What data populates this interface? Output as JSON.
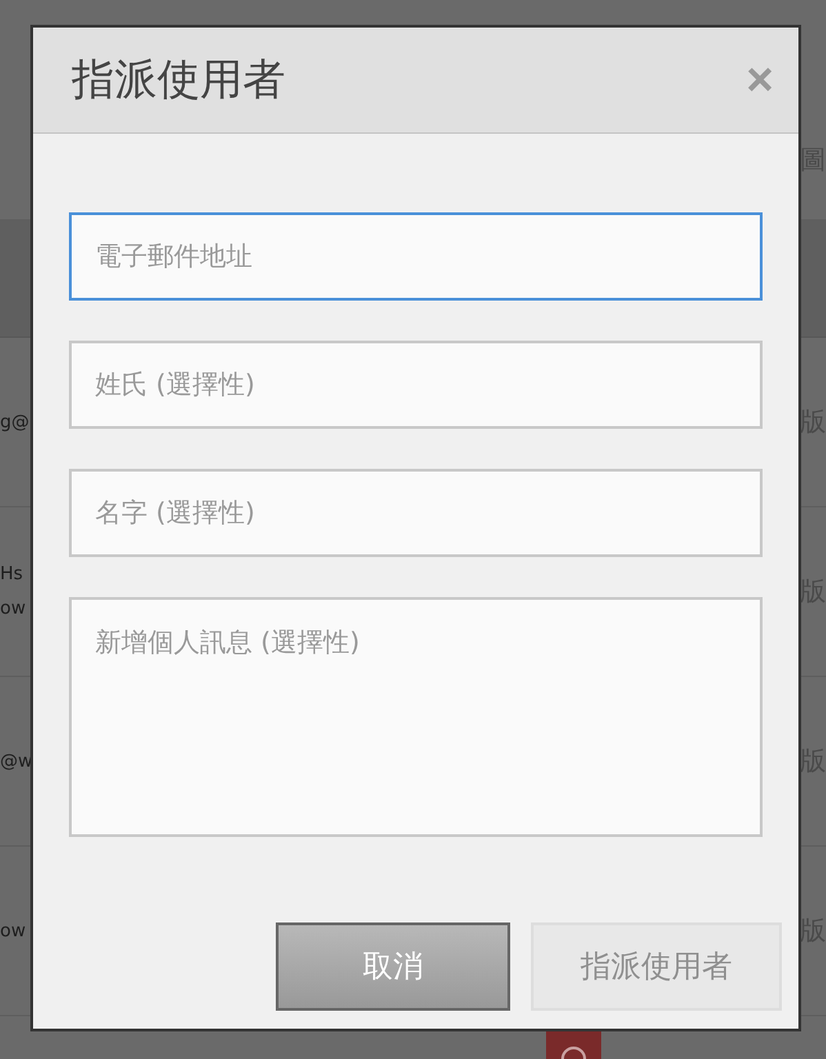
{
  "background": {
    "top_right_text": "圖",
    "rows": [
      {
        "left_lines": [
          "g@"
        ],
        "right_text": "版"
      },
      {
        "left_lines": [
          "Hs",
          "ow"
        ],
        "right_text": "版"
      },
      {
        "left_lines": [
          "@w"
        ],
        "right_text": "版"
      },
      {
        "left_lines": [
          "ow"
        ],
        "right_text": "版"
      }
    ]
  },
  "dialog": {
    "title": "指派使用者",
    "close": "×",
    "fields": [
      {
        "kind": "input",
        "placeholder": "電子郵件地址",
        "focused": true
      },
      {
        "kind": "input",
        "placeholder": "姓氏 (選擇性)",
        "focused": false
      },
      {
        "kind": "input",
        "placeholder": "名字 (選擇性)",
        "focused": false
      },
      {
        "kind": "textarea",
        "placeholder": "新增個人訊息 (選擇性)",
        "focused": false
      }
    ],
    "buttons": [
      {
        "label": "取消",
        "kind": "secondary",
        "disabled": false
      },
      {
        "label": "指派使用者",
        "kind": "primary",
        "disabled": true
      }
    ]
  }
}
